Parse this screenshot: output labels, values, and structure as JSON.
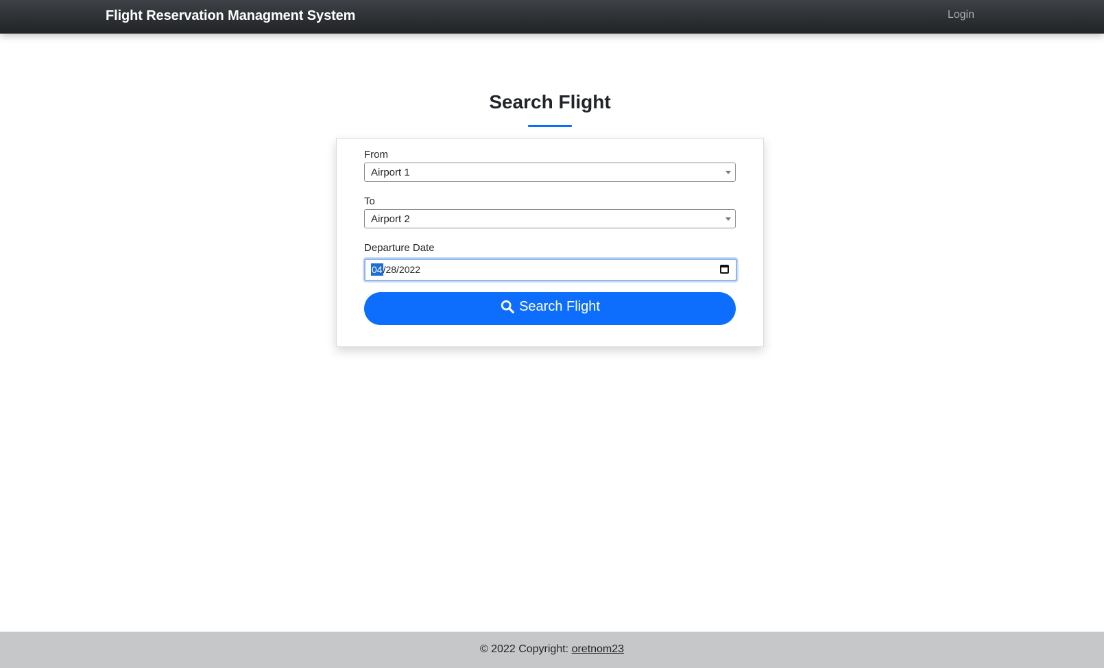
{
  "navbar": {
    "brand": "Flight Reservation Managment System",
    "login_label": "Login"
  },
  "main": {
    "title": "Search Flight",
    "accent_color": "#0d6efd"
  },
  "form": {
    "from_label": "From",
    "from_value": "Airport 1",
    "to_label": "To",
    "to_value": "Airport 2",
    "departure_label": "Departure Date",
    "date_month": "04",
    "date_rest": "/28/2022",
    "submit_label": "Search Flight",
    "submit_icon": "search-icon"
  },
  "footer": {
    "copyright": "© 2022 Copyright: ",
    "author_link": "oretnom23"
  }
}
